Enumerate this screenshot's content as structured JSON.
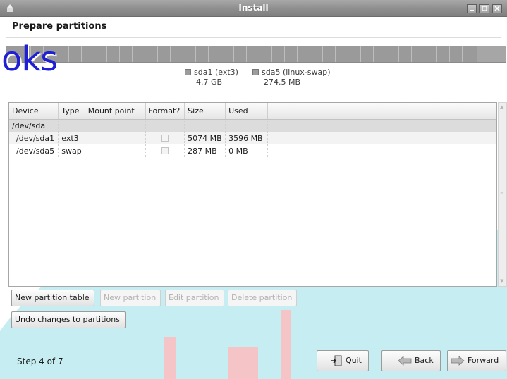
{
  "window": {
    "title": "Install",
    "minimize_icon": "minimize-icon",
    "maximize_icon": "maximize-icon",
    "close_icon": "close-icon"
  },
  "page": {
    "title": "Prepare partitions"
  },
  "watermark": "oks",
  "partition_bar": {
    "legend": [
      {
        "label": "sda1 (ext3)",
        "size": "4.7 GB",
        "color": "#9c9c9c"
      },
      {
        "label": "sda5 (linux-swap)",
        "size": "274.5 MB",
        "color": "#9c9c9c"
      }
    ]
  },
  "table": {
    "columns": [
      "Device",
      "Type",
      "Mount point",
      "Format?",
      "Size",
      "Used"
    ],
    "disk": {
      "device": "/dev/sda"
    },
    "rows": [
      {
        "device": "/dev/sda1",
        "type": "ext3",
        "mount": "",
        "format": false,
        "size": "5074 MB",
        "used": "3596 MB"
      },
      {
        "device": "/dev/sda5",
        "type": "swap",
        "mount": "",
        "format": false,
        "size": "287 MB",
        "used": "0 MB"
      }
    ]
  },
  "actions": {
    "new_table": "New partition table",
    "new_partition": "New partition",
    "edit_partition": "Edit partition",
    "delete_partition": "Delete partition",
    "undo": "Undo changes to partitions"
  },
  "footer": {
    "step": "Step 4 of 7",
    "quit": "Quit",
    "back": "Back",
    "forward": "Forward"
  },
  "colors": {
    "accent_teal": "#c6eef2",
    "accent_red": "#f4c4c6"
  }
}
